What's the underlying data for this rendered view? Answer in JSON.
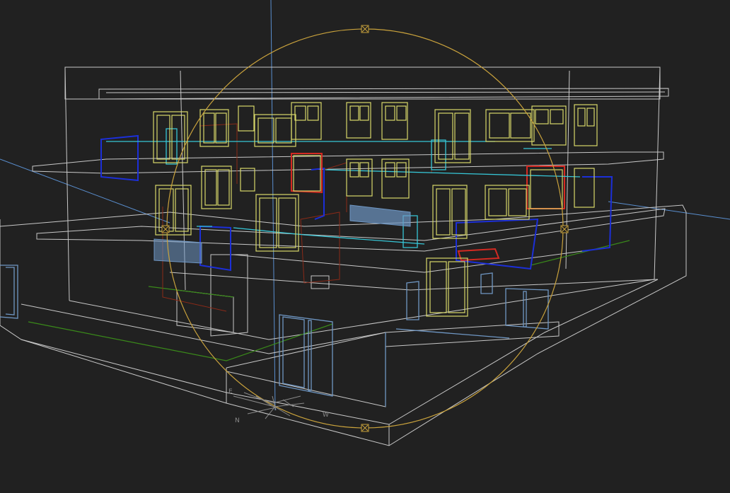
{
  "viewport": {
    "background": "#212121",
    "compass": {
      "east": "E",
      "west": "W",
      "north": "N"
    }
  },
  "colors": {
    "wall": "#c8c8c8",
    "window": "#d8d86a",
    "glass_cyan": "#36c6d6",
    "blue_frame": "#1c2fd8",
    "red_frame": "#d42a22",
    "dark_red": "#8a2a18",
    "steel_blue": "#6f97c4",
    "green": "#3a8a1a",
    "orbit": "#c9a23c",
    "axis_blue": "#5a8fd0"
  },
  "icons": {
    "orbit_grip": "orbit-grip-icon",
    "ucs": "ucs-icon"
  }
}
